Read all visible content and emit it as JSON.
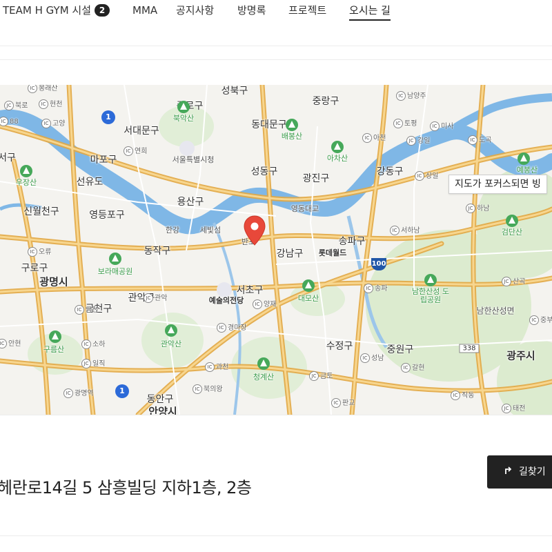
{
  "tabs": [
    {
      "label": "TEAM H GYM 시설",
      "badge": "2",
      "active": false
    },
    {
      "label": "MMA",
      "active": false
    },
    {
      "label": "공지사항",
      "active": false
    },
    {
      "label": "방명록",
      "active": false
    },
    {
      "label": "프로젝트",
      "active": false
    },
    {
      "label": "오시는 길",
      "active": true
    }
  ],
  "map": {
    "tooltip": "지도가 포커스되면 빙",
    "districts": [
      "성북구",
      "중랑구",
      "종로구",
      "서대문구",
      "동대문구",
      "마포구",
      "성동구",
      "광진구",
      "강동구",
      "용산구",
      "영등포구",
      "동작구",
      "강남구",
      "송파구",
      "구로구",
      "서초구",
      "금천구",
      "관악구",
      "수정구",
      "중원구",
      "동안구",
      "서구",
      "신월천구",
      "선유도",
      "구"
    ],
    "cities": [
      "광명시",
      "광주시",
      "안양시"
    ],
    "parks": [
      "북악산",
      "배봉산",
      "아차산",
      "예봉산",
      "우장산",
      "검단산",
      "보라매공원",
      "대모산",
      "남한산성 도립공원",
      "구름산",
      "관악산",
      "청계산",
      "남한산성면"
    ],
    "places": [
      "서울특별시청",
      "세빛섬",
      "영동대교",
      "롯데월드",
      "예술의전당",
      "한강",
      "반포"
    ],
    "ic_labels": [
      "봉래산",
      "현천",
      "북로",
      "88",
      "고양",
      "연희",
      "남양주",
      "아천",
      "토평",
      "미사",
      "강일",
      "도곡",
      "상일",
      "하남",
      "서하남",
      "산곡",
      "오류",
      "금천",
      "관악",
      "양재",
      "송파",
      "경마장",
      "소하",
      "일직",
      "과천",
      "안현",
      "북의왕",
      "광명역",
      "성남",
      "갈현",
      "금토",
      "판교",
      "직동",
      "태전",
      "중부"
    ],
    "routes": {
      "r1": "1",
      "r100": "100",
      "r338": "338"
    }
  },
  "address": "헤란로14길 5 삼흥빌딩 지하1층, 2층",
  "directions_label": "길찾기",
  "colors": {
    "water": "#7fb7e6",
    "road": "#f5c56c",
    "road_outline": "#e3a843",
    "park": "#d9ebcf",
    "marker": "#e8483a",
    "button_bg": "#222222"
  }
}
